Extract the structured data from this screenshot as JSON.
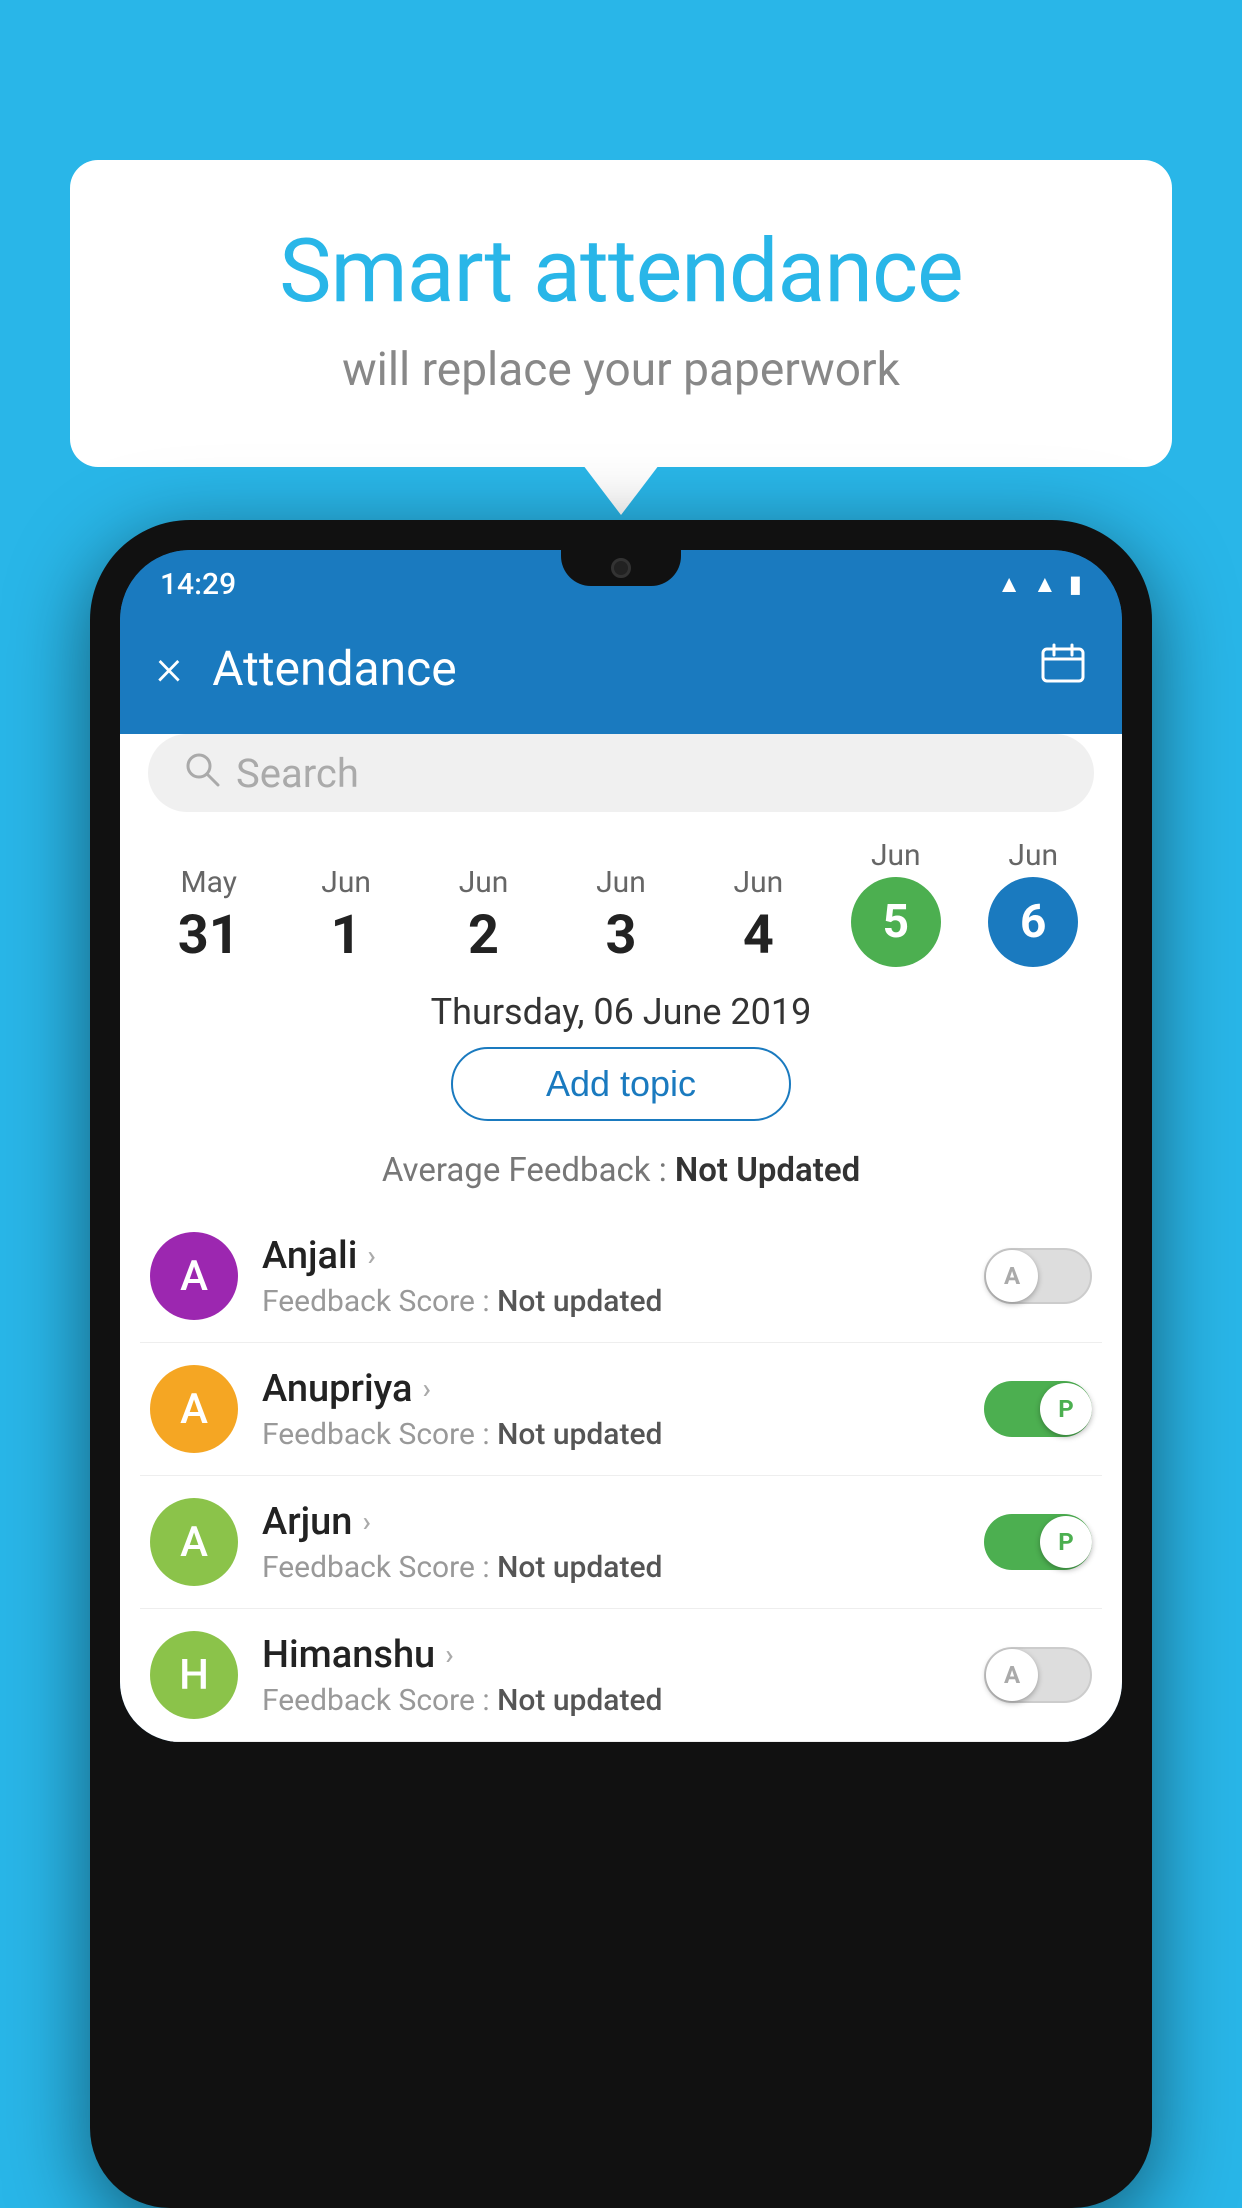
{
  "background_color": "#29b6e8",
  "bubble": {
    "title": "Smart attendance",
    "subtitle": "will replace your paperwork"
  },
  "status_bar": {
    "time": "14:29",
    "icons": [
      "wifi",
      "signal",
      "battery"
    ]
  },
  "app_bar": {
    "title": "Attendance",
    "close_label": "×",
    "calendar_icon": "📅"
  },
  "search": {
    "placeholder": "Search"
  },
  "dates": [
    {
      "month": "May",
      "day": "31",
      "state": "normal"
    },
    {
      "month": "Jun",
      "day": "1",
      "state": "normal"
    },
    {
      "month": "Jun",
      "day": "2",
      "state": "normal"
    },
    {
      "month": "Jun",
      "day": "3",
      "state": "normal"
    },
    {
      "month": "Jun",
      "day": "4",
      "state": "normal"
    },
    {
      "month": "Jun",
      "day": "5",
      "state": "today"
    },
    {
      "month": "Jun",
      "day": "6",
      "state": "selected"
    }
  ],
  "selected_date_label": "Thursday, 06 June 2019",
  "add_topic_label": "Add topic",
  "avg_feedback": {
    "label": "Average Feedback : ",
    "value": "Not Updated"
  },
  "students": [
    {
      "name": "Anjali",
      "avatar_letter": "A",
      "avatar_color": "#9c27b0",
      "feedback_label": "Feedback Score : ",
      "feedback_value": "Not updated",
      "toggle_state": "off",
      "toggle_label": "A"
    },
    {
      "name": "Anupriya",
      "avatar_letter": "A",
      "avatar_color": "#f5a623",
      "feedback_label": "Feedback Score : ",
      "feedback_value": "Not updated",
      "toggle_state": "on",
      "toggle_label": "P"
    },
    {
      "name": "Arjun",
      "avatar_letter": "A",
      "avatar_color": "#8bc34a",
      "feedback_label": "Feedback Score : ",
      "feedback_value": "Not updated",
      "toggle_state": "on",
      "toggle_label": "P"
    },
    {
      "name": "Himanshu",
      "avatar_letter": "H",
      "avatar_color": "#8bc34a",
      "feedback_label": "Feedback Score : ",
      "feedback_value": "Not updated",
      "toggle_state": "off",
      "toggle_label": "A"
    }
  ]
}
